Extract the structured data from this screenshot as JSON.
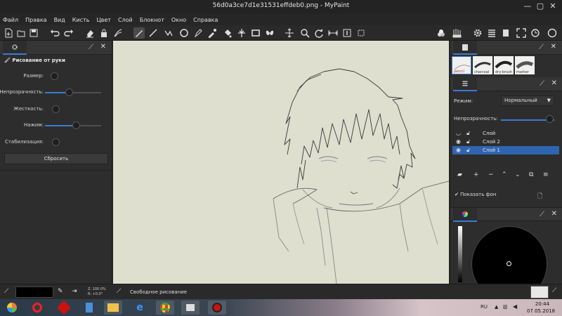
{
  "window": {
    "title": "56d0a3ce7d1e31531effdeb0.png - MyPaint",
    "controls": [
      "—",
      "▢",
      "✕"
    ]
  },
  "menu": [
    "Файл",
    "Правка",
    "Вид",
    "Кисть",
    "Цвет",
    "Слой",
    "Блокнот",
    "Окно",
    "Справка"
  ],
  "brush_panel": {
    "title": "Рисование от руки",
    "params": [
      {
        "label": "Размер:",
        "value": 0.0
      },
      {
        "label": "Непрозрачность:",
        "value": 0.45
      },
      {
        "label": "Жесткость:",
        "value": 0.0
      },
      {
        "label": "Нажим:",
        "value": 0.56
      },
      {
        "label": "Стабилизация:",
        "value": 0.0
      }
    ],
    "reset_label": "Сбросить"
  },
  "brush_thumbs": [
    "pencil",
    "charcoal",
    "dry-brush",
    "marker"
  ],
  "layers_panel": {
    "mode_label": "Режим:",
    "mode_value": "Нормальный",
    "opacity_label": "Непрозрачность:",
    "opacity_value": 1.0,
    "layers": [
      {
        "name": "Слой",
        "visible": false,
        "selected": false
      },
      {
        "name": "Слой 2",
        "visible": true,
        "selected": false
      },
      {
        "name": "Слой 1",
        "visible": true,
        "selected": true
      }
    ],
    "show_bg_label": "Показать фон",
    "show_bg_checked": true
  },
  "status": {
    "zoom": "Z: 100.0%",
    "rotation": "R: +0.0°",
    "mode_text": "Свободное рисование"
  },
  "taskbar": {
    "lang": "RU",
    "time": "20:44",
    "date": "07.05.2018"
  },
  "colors": {
    "canvas": "#dedfcf",
    "accent": "#3a7bd5",
    "panel": "#2d2d2d"
  }
}
